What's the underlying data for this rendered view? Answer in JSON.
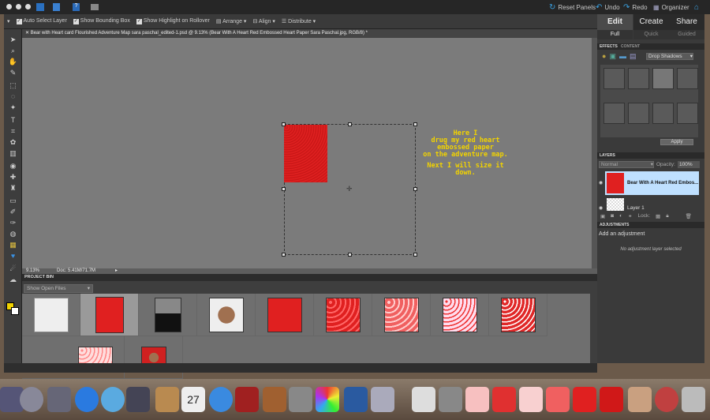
{
  "topbar": {
    "reset_panels": "Reset Panels",
    "undo": "Undo",
    "redo": "Redo",
    "organizer": "Organizer"
  },
  "options": {
    "auto_select": "Auto Select Layer",
    "show_bbox": "Show Bounding Box",
    "show_highlight": "Show Highlight on Rollover",
    "arrange": "Arrange",
    "align": "Align",
    "distribute": "Distribute"
  },
  "document": {
    "tab_title": "Bear with Heart card Flourished Adventure Map sara paschal_edited-1.psd @ 9.13% (Bear With A Heart Red Embossed Heart Paper Sara Paschal.jpg, RGB/8) *",
    "zoom": "9.13%",
    "doc_size": "Doc: 5.41M/71.7M"
  },
  "canvas_note": {
    "lines": [
      "Here I",
      "drug my red heart",
      "embossed paper",
      "on the adventure map."
    ],
    "line2": "Next I will size it down."
  },
  "modes": {
    "tabs": [
      "Edit",
      "Create",
      "Share"
    ],
    "subtabs": [
      "Full",
      "Quick",
      "Guided"
    ]
  },
  "effects": {
    "tab_effects": "EFFECTS",
    "tab_content": "CONTENT",
    "category": "Drop Shadows",
    "apply": "Apply"
  },
  "layers": {
    "title": "LAYERS",
    "blend": "Normal",
    "opacity_label": "Opacity:",
    "opacity": "100%",
    "items": [
      "Bear With A Heart Red Embos...",
      "Layer 1"
    ],
    "lock": "Lock:"
  },
  "adjustments": {
    "title": "ADJUSTMENTS",
    "add": "Add an adjustment",
    "empty": "No adjustment layer selected"
  },
  "project_bin": {
    "title": "PROJECT BIN",
    "filter": "Show Open Files"
  },
  "colors": {
    "accent": "#3aa0e0",
    "note": "#f2d300",
    "paper_red": "#e42020"
  }
}
